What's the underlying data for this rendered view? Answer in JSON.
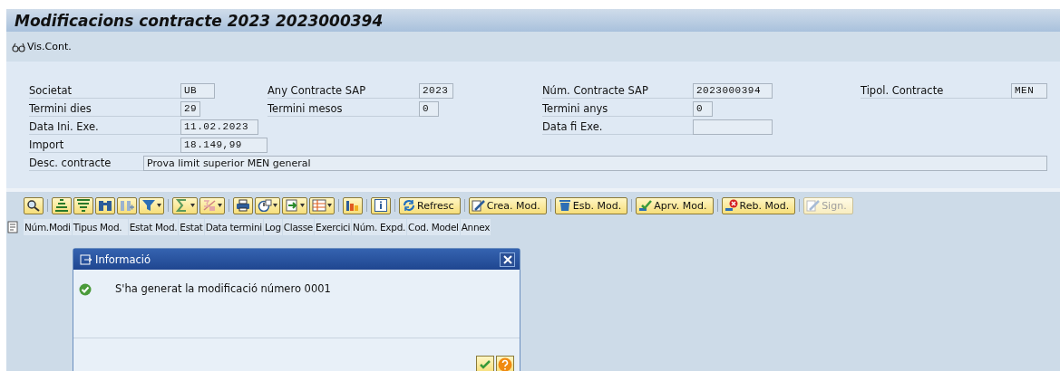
{
  "window": {
    "title": "Modificacions contracte 2023 2023000394"
  },
  "app_toolbar": [
    {
      "label": "Vis.Cont."
    }
  ],
  "form": {
    "columns": [
      {
        "fields": [
          {
            "label": "Societat",
            "value": "UB"
          },
          {
            "label": "Termini dies",
            "value": "29"
          },
          {
            "label": "Data Ini. Exe.",
            "value": "11.02.2023"
          },
          {
            "label": "Import",
            "value": "18.149,99"
          }
        ]
      },
      {
        "fields": [
          {
            "label": "Any Contracte SAP",
            "value": "2023"
          },
          {
            "label": "Termini mesos",
            "value": "0"
          }
        ]
      },
      {
        "fields": [
          {
            "label": "Núm. Contracte SAP",
            "value": "2023000394"
          },
          {
            "label": "Termini anys",
            "value": "0"
          },
          {
            "label": "Data fi Exe."
          }
        ]
      },
      {
        "fields": [
          {
            "label": "Tipol. Contracte",
            "value": "MEN"
          }
        ]
      }
    ],
    "description": {
      "label": "Desc. contracte",
      "value": "Prova limit superior MEN general"
    }
  },
  "grid_toolbar": {
    "buttons": [
      {
        "label": "Refresc",
        "disabled": false
      },
      {
        "label": "Crea. Mod.",
        "disabled": false
      },
      {
        "label": "Esb. Mod.",
        "disabled": false
      },
      {
        "label": "Aprv. Mod.",
        "disabled": false
      },
      {
        "label": "Reb. Mod.",
        "disabled": false
      },
      {
        "label": "Sign.",
        "disabled": true
      }
    ]
  },
  "table": {
    "columns": [
      "Núm.Modi",
      "Tipus Mod.",
      "Estat Mod.",
      "Estat",
      "Data termini",
      "Log",
      "Classe",
      "Exercici",
      "Núm. Expd.",
      "Cod. Model",
      "Annex"
    ]
  },
  "dialog": {
    "title": "Informació",
    "message": "S'ha generat la modificació número 0001"
  }
}
